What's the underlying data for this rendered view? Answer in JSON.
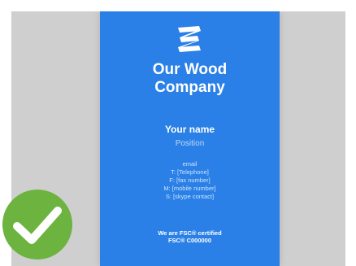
{
  "card": {
    "logo_icon": "stripe-s-logo-icon",
    "company_line1": "Our Wood",
    "company_line2": "Company",
    "name": "Your name",
    "position": "Position",
    "contacts": [
      "email",
      "T: [Telephone]",
      "F: [fax number]",
      "M: [mobile number]",
      "S: [skype contact]"
    ],
    "fsc_line1": "We are FSC® certified",
    "fsc_line2": "FSC® C000000"
  },
  "badge": {
    "icon": "checkmark-icon",
    "color": "#6cb33f"
  },
  "colors": {
    "card_bg": "#2a80e6",
    "frame_bg": "#cfcfcf"
  }
}
